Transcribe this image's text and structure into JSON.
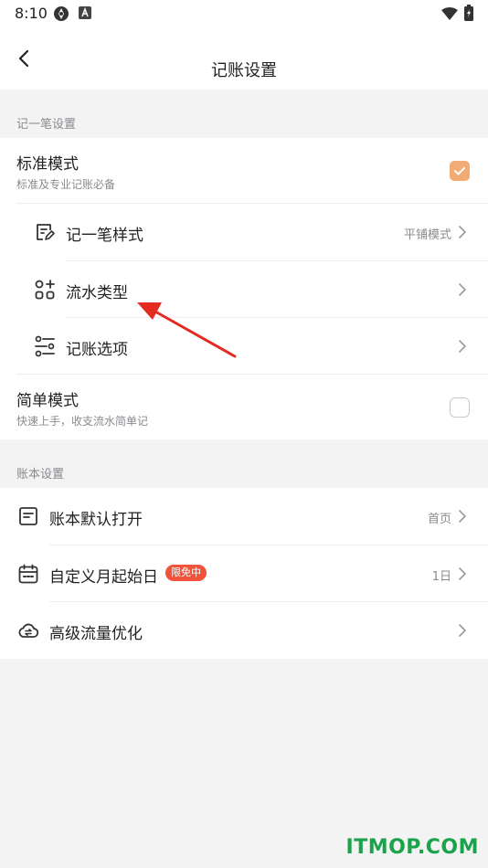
{
  "status_bar": {
    "time": "8:10"
  },
  "app_bar": {
    "title": "记账设置"
  },
  "section_record": {
    "label": "记一笔设置",
    "standard_mode": {
      "title": "标准模式",
      "subtitle": "标准及专业记账必备",
      "checked": true
    },
    "sub_items": [
      {
        "label": "记一笔样式",
        "value": "平铺模式",
        "icon": "edit-note-icon"
      },
      {
        "label": "流水类型",
        "value": "",
        "icon": "grid-add-icon"
      },
      {
        "label": "记账选项",
        "value": "",
        "icon": "sliders-icon"
      }
    ],
    "simple_mode": {
      "title": "简单模式",
      "subtitle": "快速上手，收支流水简单记",
      "checked": false
    }
  },
  "section_book": {
    "label": "账本设置",
    "items": [
      {
        "label": "账本默认打开",
        "value": "首页",
        "icon": "document-icon"
      },
      {
        "label": "自定义月起始日",
        "badge": "限免中",
        "value": "1日",
        "icon": "calendar-icon"
      },
      {
        "label": "高级流量优化",
        "value": "",
        "icon": "cloud-sync-icon"
      }
    ]
  },
  "watermark": {
    "text": "ITMOP.COM"
  },
  "colors": {
    "accent": "#f2ab73",
    "badge": "#f0533a",
    "arrow": "#e52a22",
    "watermark": "#1aa34a"
  }
}
